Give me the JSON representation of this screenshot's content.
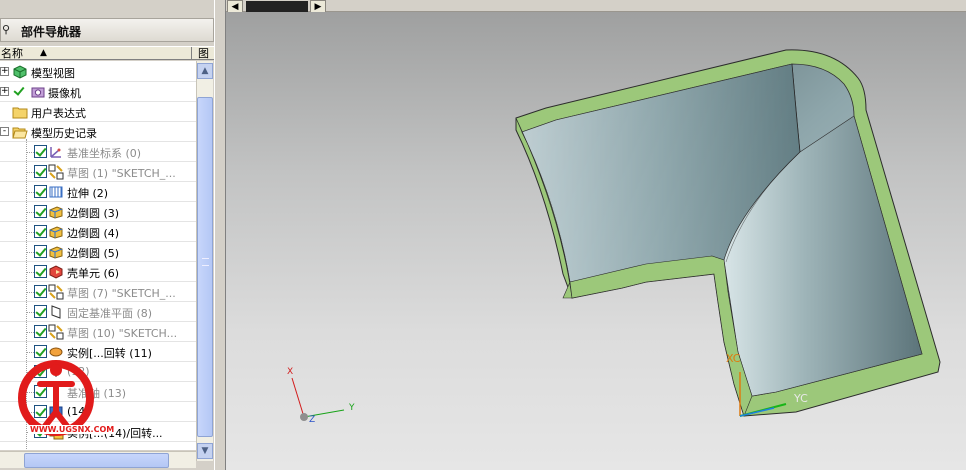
{
  "navigator": {
    "title": "部件导航器",
    "columns": {
      "name": "名称",
      "figure": "图"
    },
    "rows": [
      {
        "label": "模型视图",
        "grey": false,
        "checked": false,
        "expander": "+",
        "icon": "model-views-icon"
      },
      {
        "label": "摄像机",
        "grey": false,
        "checked": true,
        "expander": "+",
        "icon": "camera-icon"
      },
      {
        "label": "用户表达式",
        "grey": false,
        "checked": false,
        "expander": "",
        "icon": "folder-icon"
      },
      {
        "label": "模型历史记录",
        "grey": false,
        "checked": false,
        "expander": "-",
        "icon": "folder-open-icon"
      },
      {
        "label": "基准坐标系 (0)",
        "grey": true,
        "checked": true,
        "icon": "datum-csys-icon"
      },
      {
        "label": "草图 (1) \"SKETCH_...",
        "grey": true,
        "checked": true,
        "icon": "sketch-icon"
      },
      {
        "label": "拉伸 (2)",
        "grey": false,
        "checked": true,
        "icon": "extrude-icon"
      },
      {
        "label": "边倒圆 (3)",
        "grey": false,
        "checked": true,
        "icon": "edge-blend-icon"
      },
      {
        "label": "边倒圆 (4)",
        "grey": false,
        "checked": true,
        "icon": "edge-blend-icon"
      },
      {
        "label": "边倒圆 (5)",
        "grey": false,
        "checked": true,
        "icon": "edge-blend-icon"
      },
      {
        "label": "壳单元 (6)",
        "grey": false,
        "checked": true,
        "icon": "shell-icon"
      },
      {
        "label": "草图 (7) \"SKETCH_...",
        "grey": true,
        "checked": true,
        "icon": "sketch-icon"
      },
      {
        "label": "固定基准平面 (8)",
        "grey": true,
        "checked": true,
        "icon": "datum-plane-icon"
      },
      {
        "label": "草图 (10) \"SKETCH...",
        "grey": true,
        "checked": true,
        "icon": "sketch-icon"
      },
      {
        "label": "实例[...回转 (11)",
        "grey": false,
        "checked": true,
        "icon": "revolve-icon"
      },
      {
        "label": "(12)",
        "grey": true,
        "checked": true,
        "icon": "point-icon"
      },
      {
        "label": "基准轴 (13)",
        "grey": true,
        "checked": true,
        "icon": "datum-axis-icon"
      },
      {
        "label": "(14)",
        "grey": false,
        "checked": true,
        "icon": "body-icon"
      },
      {
        "label": "实例[...(14)/回转...",
        "grey": false,
        "checked": true,
        "icon": "instance-icon"
      }
    ]
  },
  "viewport": {
    "triad": {
      "x": "X",
      "y": "Y",
      "z": "Z"
    },
    "wcs": {
      "xc": "XC",
      "yc": "YC"
    },
    "colors": {
      "part_face": "#9cc87a",
      "part_body": "#6f8d92",
      "bg_top": "#9fa0a0",
      "bg_bottom": "#e6e6e6"
    }
  },
  "watermark": {
    "text": "WWW.UGSNX.COM",
    "brand": "UG爱好者"
  }
}
